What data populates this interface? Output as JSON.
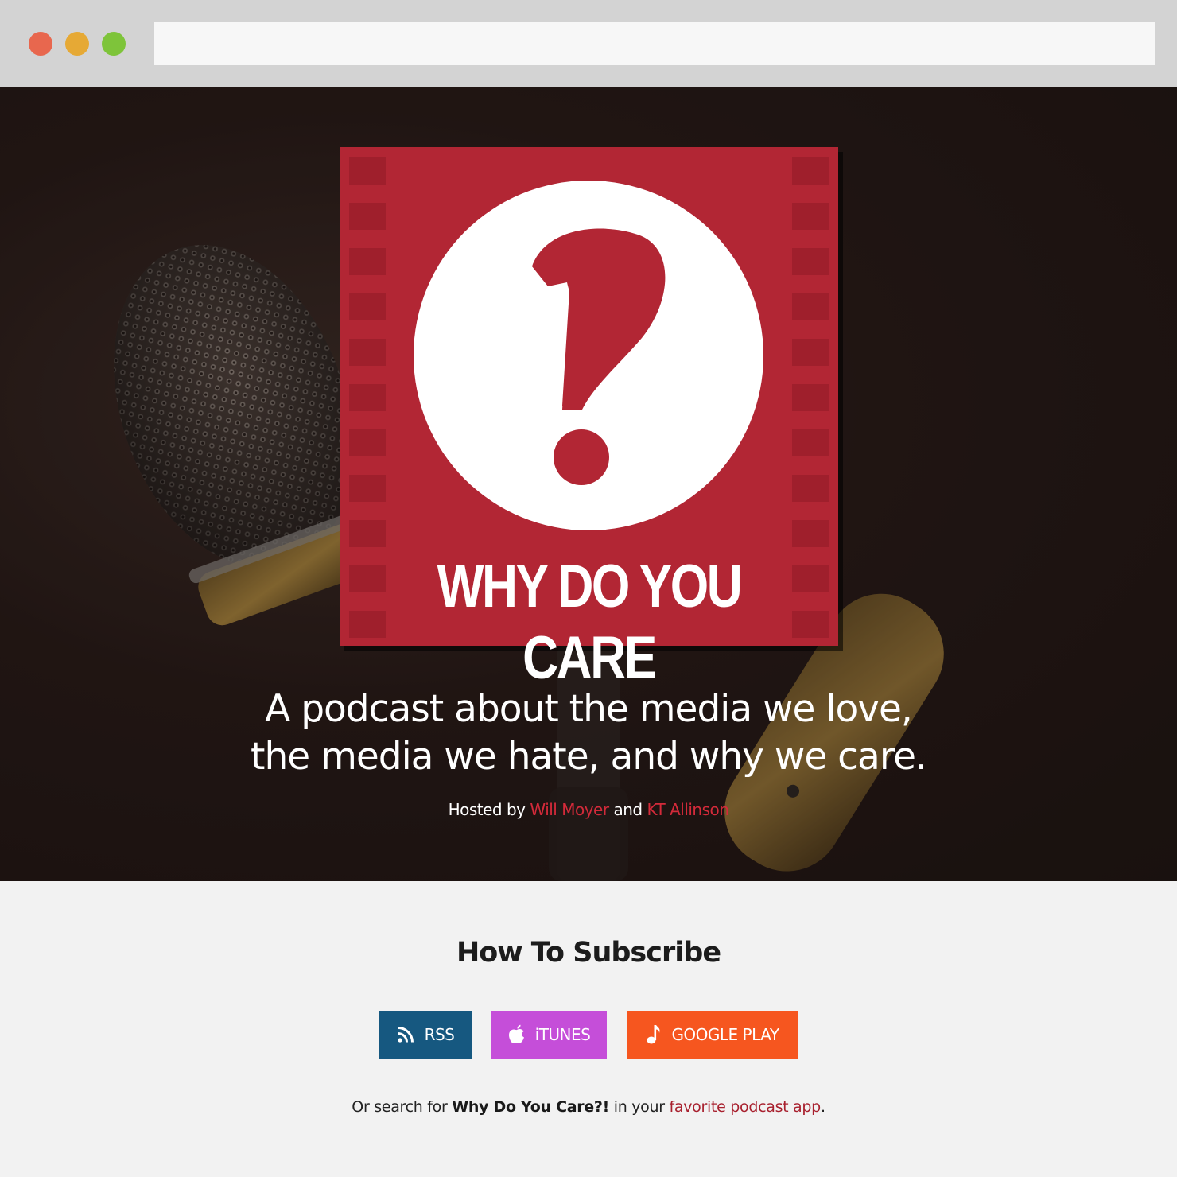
{
  "browser": {
    "url": ""
  },
  "cover": {
    "title": "WHY DO YOU CARE"
  },
  "hero": {
    "tagline_line1": "A podcast about the media we love,",
    "tagline_line2": "the media we hate, and why we care.",
    "hosted_by": "Hosted by",
    "host1": "Will Moyer",
    "and": "and",
    "host2": "KT Allinson"
  },
  "subscribe": {
    "title": "How To Subscribe",
    "buttons": [
      {
        "label": "RSS",
        "icon": "rss-icon",
        "color": "#165880"
      },
      {
        "label": "iTUNES",
        "icon": "apple-icon",
        "color": "#c54ed9"
      },
      {
        "label": "GOOGLE PLAY",
        "icon": "music-note-icon",
        "color": "#f6561f"
      }
    ],
    "note_prefix": "Or search for",
    "note_bold": "Why Do You Care?!",
    "note_middle": "in your",
    "note_link": "favorite podcast app",
    "note_suffix": "."
  },
  "colors": {
    "accent_red": "#b22634",
    "link_red": "#d42a3a"
  }
}
